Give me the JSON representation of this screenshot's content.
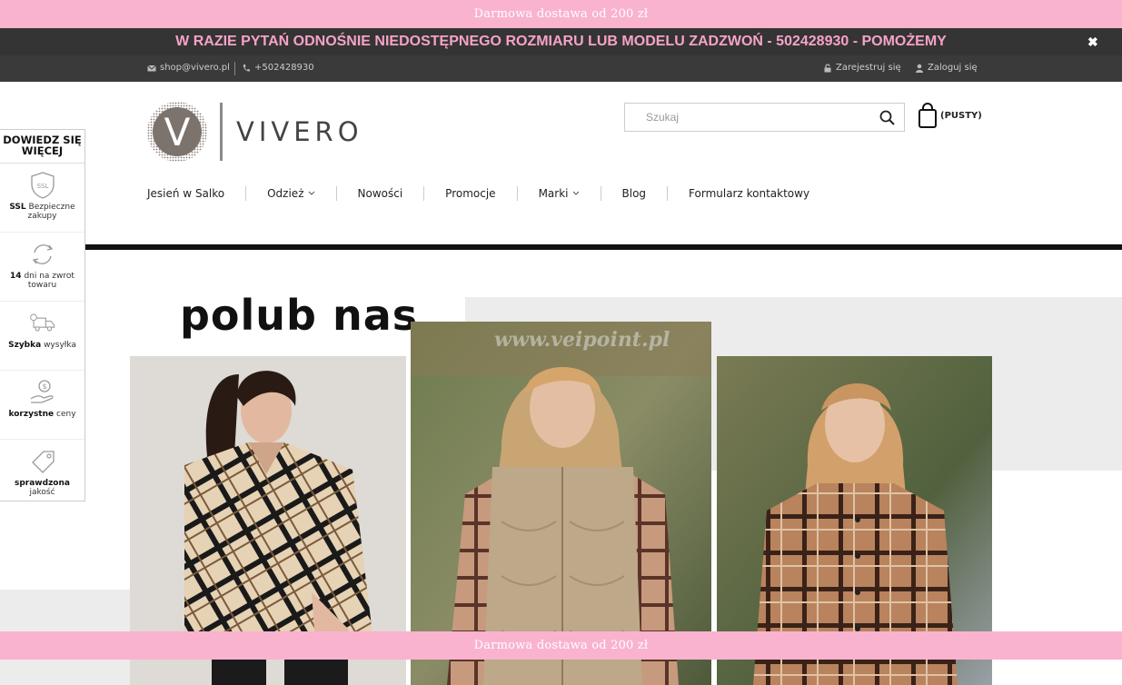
{
  "promo_bar": {
    "text": "Darmowa dostawa od 200 zł"
  },
  "notice": {
    "text": "W RAZIE PYTAŃ ODNOŚNIE NIEDOSTĘPNEGO ROZMIARU LUB MODELU ZADZWOŃ -  502428930 - POMOŻEMY",
    "close": "✖"
  },
  "topbar": {
    "email": "shop@vivero.pl",
    "phone": "+502428930",
    "register": "Zarejestruj się",
    "login": "Zaloguj się"
  },
  "header": {
    "logo_text": "VIVERO",
    "logo_letter": "V",
    "search_placeholder": "Szukaj",
    "cart_label": "(PUSTY)"
  },
  "nav": {
    "items": [
      {
        "label": "Jesień w Salko",
        "dropdown": false
      },
      {
        "label": "Odzież",
        "dropdown": true
      },
      {
        "label": "Nowości",
        "dropdown": false
      },
      {
        "label": "Promocje",
        "dropdown": false
      },
      {
        "label": "Marki",
        "dropdown": true
      },
      {
        "label": "Blog",
        "dropdown": false
      },
      {
        "label": "Formularz kontaktowy",
        "dropdown": false
      }
    ]
  },
  "sidebar": {
    "title": "DOWIEDZ SIĘ WIĘCEJ",
    "features": [
      {
        "bold": "SSL",
        "text": "Bezpieczne zakupy",
        "icon": "ssl-shield-icon"
      },
      {
        "bold": "14",
        "text": "dni na zwrot towaru",
        "icon": "return-arrows-icon"
      },
      {
        "bold": "Szybka",
        "text": "wysyłka",
        "icon": "delivery-truck-icon"
      },
      {
        "bold": "korzystne",
        "text": "ceny",
        "icon": "money-hand-icon"
      },
      {
        "bold": "sprawdzona",
        "text": "jakość",
        "icon": "price-tag-icon"
      }
    ]
  },
  "banner": {
    "heading": "polub nas",
    "watermark": "www.veipoint.pl"
  },
  "colors": {
    "promo_pink": "#f9b3cf",
    "notice_bg": "#343434",
    "notice_text": "#f7a2c8",
    "topbar_bg": "#3a3a3a"
  }
}
